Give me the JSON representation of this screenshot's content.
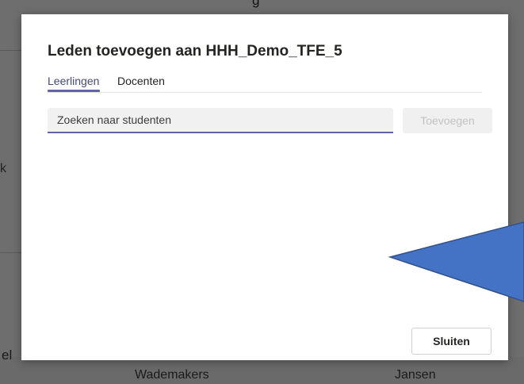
{
  "background": {
    "top_text_fragment": "g",
    "left_text_fragment": "k",
    "bottom_left_fragment": "el",
    "bottom_text_1": "Wademakers",
    "bottom_text_2": "Jansen"
  },
  "dialog": {
    "title": "Leden toevoegen aan HHH_Demo_TFE_5",
    "tabs": [
      {
        "label": "Leerlingen",
        "active": true
      },
      {
        "label": "Docenten",
        "active": false
      }
    ],
    "search": {
      "value": "",
      "placeholder": "Zoeken naar studenten"
    },
    "add_button_label": "Toevoegen",
    "close_button_label": "Sluiten"
  },
  "colors": {
    "accent": "#6264a7",
    "annotation_fill": "#4472c4",
    "annotation_stroke": "#2f528f"
  }
}
